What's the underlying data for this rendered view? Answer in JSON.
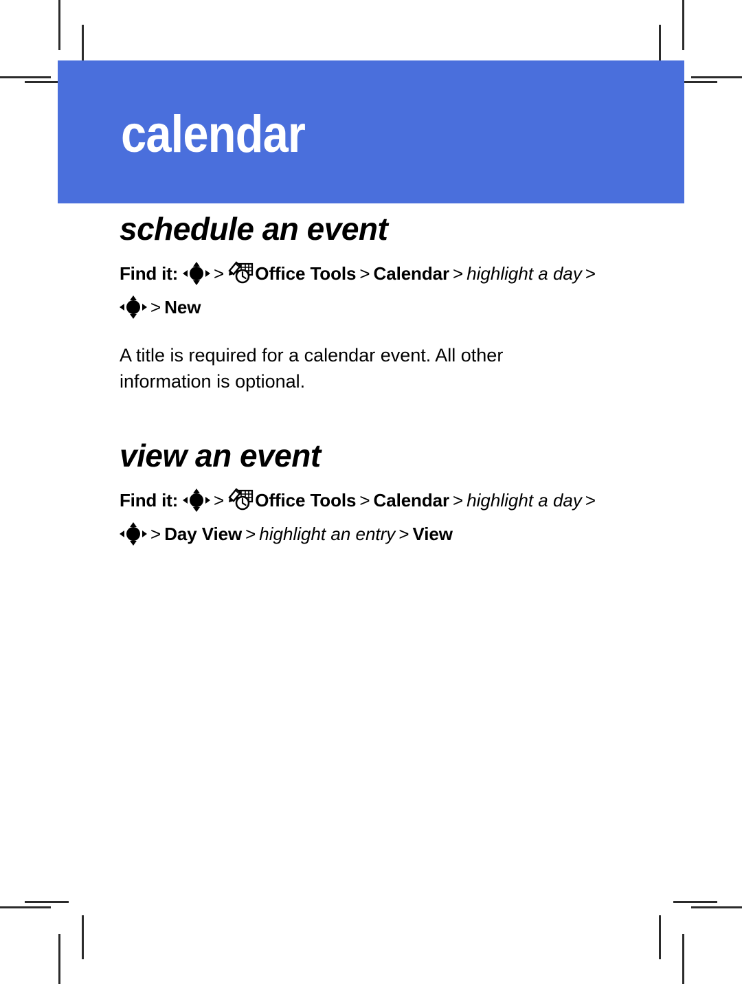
{
  "page": {
    "banner_title": "calendar",
    "banner_color": "#4a6fdc",
    "background_color": "#ffffff",
    "text_color": "#000000"
  },
  "icons": {
    "navkey": "navigation-key-icon",
    "office_tools": "office-tools-icon"
  },
  "sections": [
    {
      "heading": "schedule an event",
      "findit": {
        "label": "Find it:",
        "separator": ">",
        "line1": [
          {
            "type": "icon",
            "icon": "navkey"
          },
          {
            "type": "sep",
            "text": ">"
          },
          {
            "type": "icon",
            "icon": "office_tools"
          },
          {
            "type": "menu",
            "text": "Office Tools"
          },
          {
            "type": "sep",
            "text": ">"
          },
          {
            "type": "menu",
            "text": "Calendar"
          },
          {
            "type": "sep",
            "text": ">"
          },
          {
            "type": "instr",
            "text": "highlight a day"
          },
          {
            "type": "sep",
            "text": ">"
          }
        ],
        "line2": [
          {
            "type": "icon",
            "icon": "navkey"
          },
          {
            "type": "sep",
            "text": ">"
          },
          {
            "type": "menu",
            "text": "New"
          }
        ]
      },
      "body": "A title is required for a calendar event. All other information is optional."
    },
    {
      "heading": "view an event",
      "findit": {
        "label": "Find it:",
        "separator": ">",
        "line1": [
          {
            "type": "icon",
            "icon": "navkey"
          },
          {
            "type": "sep",
            "text": ">"
          },
          {
            "type": "icon",
            "icon": "office_tools"
          },
          {
            "type": "menu",
            "text": "Office Tools"
          },
          {
            "type": "sep",
            "text": ">"
          },
          {
            "type": "menu",
            "text": "Calendar"
          },
          {
            "type": "sep",
            "text": ">"
          },
          {
            "type": "instr",
            "text": "highlight a day"
          },
          {
            "type": "sep",
            "text": ">"
          }
        ],
        "line2": [
          {
            "type": "icon",
            "icon": "navkey"
          },
          {
            "type": "sep",
            "text": ">"
          },
          {
            "type": "menu",
            "text": "Day View"
          },
          {
            "type": "sep",
            "text": ">"
          },
          {
            "type": "instr",
            "text": "highlight an entry"
          },
          {
            "type": "sep",
            "text": ">"
          },
          {
            "type": "menu",
            "text": "View"
          }
        ]
      },
      "body": null
    }
  ],
  "crop_marks": {
    "present": true,
    "corners": [
      "top-left",
      "top-right",
      "bottom-left",
      "bottom-right"
    ]
  }
}
